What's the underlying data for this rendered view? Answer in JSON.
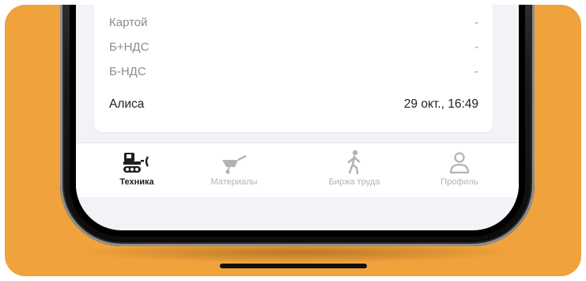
{
  "payment_rows": [
    {
      "label": "Картой",
      "value": "-"
    },
    {
      "label": "Б+НДС",
      "value": "-"
    },
    {
      "label": "Б-НДС",
      "value": "-"
    }
  ],
  "footer": {
    "author": "Алиса",
    "datetime": "29 окт., 16:49"
  },
  "tabs": [
    {
      "label": "Техника",
      "icon": "equipment-icon",
      "active": true
    },
    {
      "label": "Материалы",
      "icon": "wheelbarrow-icon",
      "active": false
    },
    {
      "label": "Биржа труда",
      "icon": "walking-person-icon",
      "active": false
    },
    {
      "label": "Профиль",
      "icon": "profile-icon",
      "active": false
    }
  ],
  "colors": {
    "background": "#f0a23c",
    "active_tab": "#1f1f1f",
    "inactive_tab": "#b3b3b3"
  }
}
